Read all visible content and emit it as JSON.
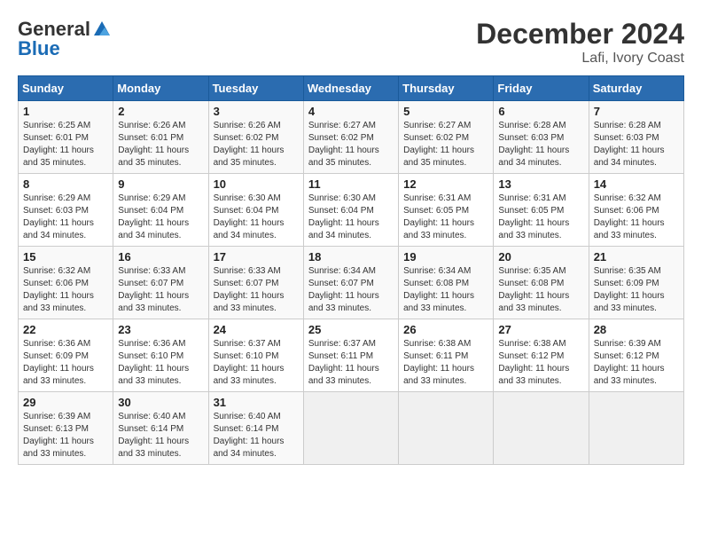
{
  "header": {
    "logo_line1": "General",
    "logo_line2": "Blue",
    "month_year": "December 2024",
    "location": "Lafi, Ivory Coast"
  },
  "weekdays": [
    "Sunday",
    "Monday",
    "Tuesday",
    "Wednesday",
    "Thursday",
    "Friday",
    "Saturday"
  ],
  "weeks": [
    [
      {
        "day": "1",
        "info": "Sunrise: 6:25 AM\nSunset: 6:01 PM\nDaylight: 11 hours\nand 35 minutes."
      },
      {
        "day": "2",
        "info": "Sunrise: 6:26 AM\nSunset: 6:01 PM\nDaylight: 11 hours\nand 35 minutes."
      },
      {
        "day": "3",
        "info": "Sunrise: 6:26 AM\nSunset: 6:02 PM\nDaylight: 11 hours\nand 35 minutes."
      },
      {
        "day": "4",
        "info": "Sunrise: 6:27 AM\nSunset: 6:02 PM\nDaylight: 11 hours\nand 35 minutes."
      },
      {
        "day": "5",
        "info": "Sunrise: 6:27 AM\nSunset: 6:02 PM\nDaylight: 11 hours\nand 35 minutes."
      },
      {
        "day": "6",
        "info": "Sunrise: 6:28 AM\nSunset: 6:03 PM\nDaylight: 11 hours\nand 34 minutes."
      },
      {
        "day": "7",
        "info": "Sunrise: 6:28 AM\nSunset: 6:03 PM\nDaylight: 11 hours\nand 34 minutes."
      }
    ],
    [
      {
        "day": "8",
        "info": "Sunrise: 6:29 AM\nSunset: 6:03 PM\nDaylight: 11 hours\nand 34 minutes."
      },
      {
        "day": "9",
        "info": "Sunrise: 6:29 AM\nSunset: 6:04 PM\nDaylight: 11 hours\nand 34 minutes."
      },
      {
        "day": "10",
        "info": "Sunrise: 6:30 AM\nSunset: 6:04 PM\nDaylight: 11 hours\nand 34 minutes."
      },
      {
        "day": "11",
        "info": "Sunrise: 6:30 AM\nSunset: 6:04 PM\nDaylight: 11 hours\nand 34 minutes."
      },
      {
        "day": "12",
        "info": "Sunrise: 6:31 AM\nSunset: 6:05 PM\nDaylight: 11 hours\nand 33 minutes."
      },
      {
        "day": "13",
        "info": "Sunrise: 6:31 AM\nSunset: 6:05 PM\nDaylight: 11 hours\nand 33 minutes."
      },
      {
        "day": "14",
        "info": "Sunrise: 6:32 AM\nSunset: 6:06 PM\nDaylight: 11 hours\nand 33 minutes."
      }
    ],
    [
      {
        "day": "15",
        "info": "Sunrise: 6:32 AM\nSunset: 6:06 PM\nDaylight: 11 hours\nand 33 minutes."
      },
      {
        "day": "16",
        "info": "Sunrise: 6:33 AM\nSunset: 6:07 PM\nDaylight: 11 hours\nand 33 minutes."
      },
      {
        "day": "17",
        "info": "Sunrise: 6:33 AM\nSunset: 6:07 PM\nDaylight: 11 hours\nand 33 minutes."
      },
      {
        "day": "18",
        "info": "Sunrise: 6:34 AM\nSunset: 6:07 PM\nDaylight: 11 hours\nand 33 minutes."
      },
      {
        "day": "19",
        "info": "Sunrise: 6:34 AM\nSunset: 6:08 PM\nDaylight: 11 hours\nand 33 minutes."
      },
      {
        "day": "20",
        "info": "Sunrise: 6:35 AM\nSunset: 6:08 PM\nDaylight: 11 hours\nand 33 minutes."
      },
      {
        "day": "21",
        "info": "Sunrise: 6:35 AM\nSunset: 6:09 PM\nDaylight: 11 hours\nand 33 minutes."
      }
    ],
    [
      {
        "day": "22",
        "info": "Sunrise: 6:36 AM\nSunset: 6:09 PM\nDaylight: 11 hours\nand 33 minutes."
      },
      {
        "day": "23",
        "info": "Sunrise: 6:36 AM\nSunset: 6:10 PM\nDaylight: 11 hours\nand 33 minutes."
      },
      {
        "day": "24",
        "info": "Sunrise: 6:37 AM\nSunset: 6:10 PM\nDaylight: 11 hours\nand 33 minutes."
      },
      {
        "day": "25",
        "info": "Sunrise: 6:37 AM\nSunset: 6:11 PM\nDaylight: 11 hours\nand 33 minutes."
      },
      {
        "day": "26",
        "info": "Sunrise: 6:38 AM\nSunset: 6:11 PM\nDaylight: 11 hours\nand 33 minutes."
      },
      {
        "day": "27",
        "info": "Sunrise: 6:38 AM\nSunset: 6:12 PM\nDaylight: 11 hours\nand 33 minutes."
      },
      {
        "day": "28",
        "info": "Sunrise: 6:39 AM\nSunset: 6:12 PM\nDaylight: 11 hours\nand 33 minutes."
      }
    ],
    [
      {
        "day": "29",
        "info": "Sunrise: 6:39 AM\nSunset: 6:13 PM\nDaylight: 11 hours\nand 33 minutes."
      },
      {
        "day": "30",
        "info": "Sunrise: 6:40 AM\nSunset: 6:14 PM\nDaylight: 11 hours\nand 33 minutes."
      },
      {
        "day": "31",
        "info": "Sunrise: 6:40 AM\nSunset: 6:14 PM\nDaylight: 11 hours\nand 34 minutes."
      },
      {
        "day": "",
        "info": ""
      },
      {
        "day": "",
        "info": ""
      },
      {
        "day": "",
        "info": ""
      },
      {
        "day": "",
        "info": ""
      }
    ]
  ]
}
